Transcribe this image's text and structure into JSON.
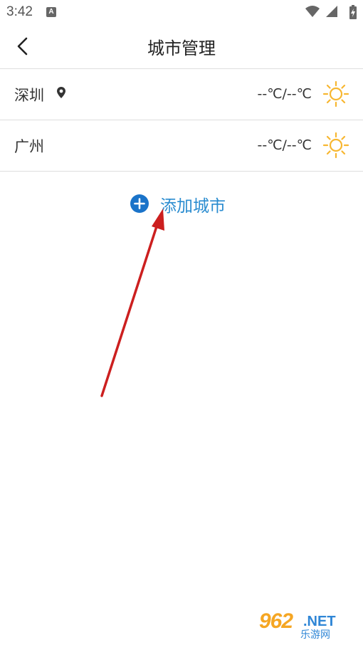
{
  "status_bar": {
    "time": "3:42",
    "notification_icon": "a-icon",
    "icons": [
      "wifi-icon",
      "signal-icon",
      "battery-charging-icon"
    ]
  },
  "header": {
    "title": "城市管理",
    "back_icon": "chevron-left-icon"
  },
  "cities": [
    {
      "name": "深圳",
      "location_icon": "location-pin-icon",
      "temperature": "--℃/--℃",
      "weather_icon": "sun-icon"
    },
    {
      "name": "广州",
      "temperature": "--℃/--℃",
      "weather_icon": "sun-icon"
    }
  ],
  "add_city": {
    "label": "添加城市",
    "icon": "plus-circle-icon"
  },
  "annotation": {
    "icon": "red-arrow"
  },
  "watermark": {
    "number": "962",
    "suffix": ".NET",
    "subtitle": "乐游网"
  },
  "colors": {
    "accent": "#2a8cd0",
    "add_icon": "#1a73c9",
    "sun": "#f7b731",
    "arrow": "#cc1f1f",
    "divider": "#dedede"
  }
}
